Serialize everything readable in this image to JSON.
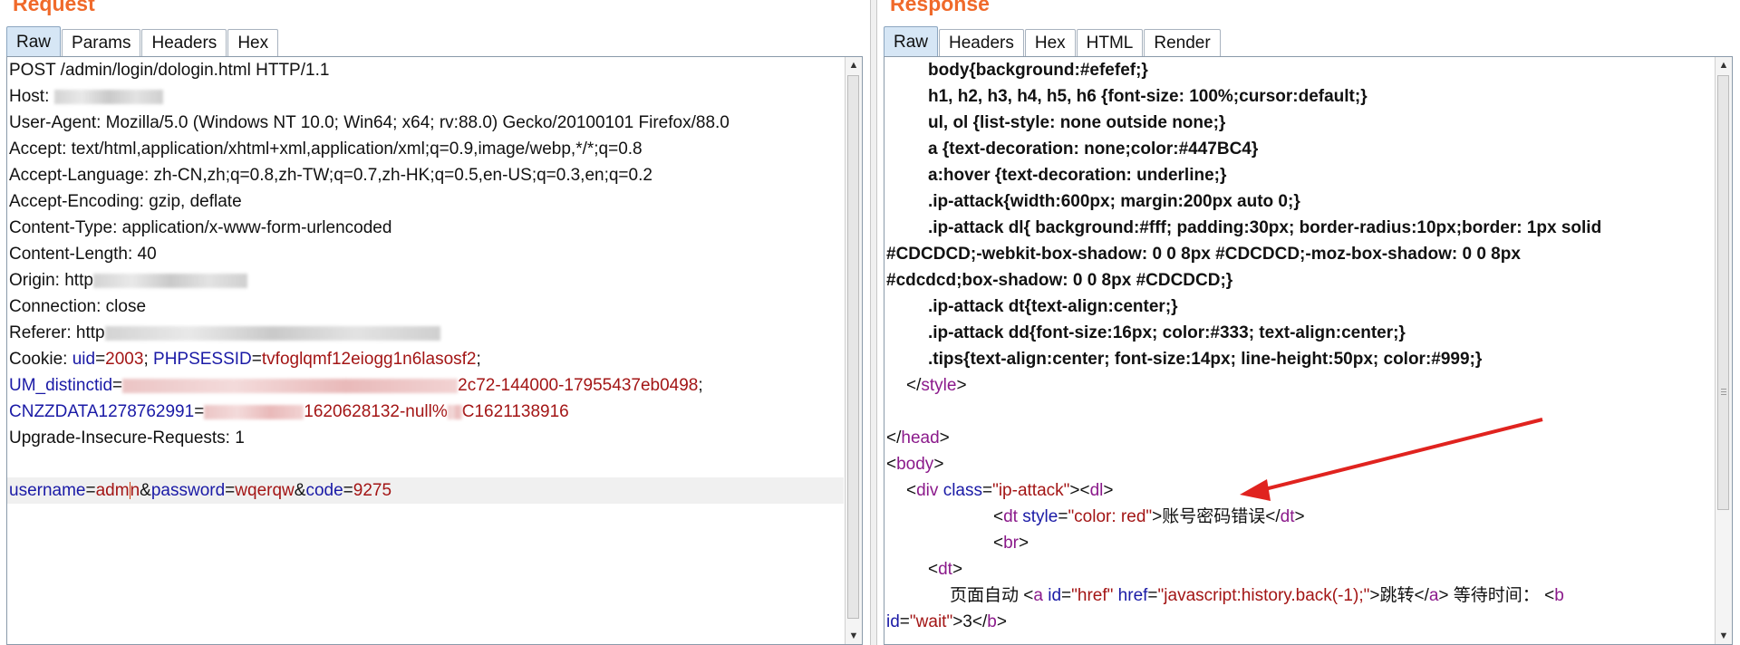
{
  "request": {
    "title": "Request",
    "tabs": [
      "Raw",
      "Params",
      "Headers",
      "Hex"
    ],
    "lines": {
      "l1": "POST /admin/login/dologin.html HTTP/1.1",
      "l2": "Host: ",
      "l3": "User-Agent: Mozilla/5.0 (Windows NT 10.0; Win64; x64; rv:88.0) Gecko/20100101 Firefox/88.0",
      "l4": "Accept: text/html,application/xhtml+xml,application/xml;q=0.9,image/webp,*/*;q=0.8",
      "l5": "Accept-Language: zh-CN,zh;q=0.8,zh-TW;q=0.7,zh-HK;q=0.5,en-US;q=0.3,en;q=0.2",
      "l6": "Accept-Encoding: gzip, deflate",
      "l7": "Content-Type: application/x-www-form-urlencoded",
      "l8": "Content-Length: 40",
      "l9": "Origin: http",
      "l10": "Connection: close",
      "l11": "Referer: http",
      "cookie": {
        "label": "Cookie: ",
        "k1": "uid",
        "v1": "2003",
        "k2": "PHPSESSID",
        "v2": "tvfoglqmf12eiogg1n6lasosf2",
        "k3": "UM_distinctid",
        "v3_tail": "2c72-144000-17955437eb0498",
        "k4": "CNZZDATA1278762991",
        "v4_mid": "1620628132-null%",
        "v4_tail": "C1621138916"
      },
      "l15": "Upgrade-Insecure-Requests: 1",
      "body": {
        "k1": "username",
        "v1a": "adm",
        "v1b": "n",
        "k2": "password",
        "v2": "wqerqw",
        "k3": "code",
        "v3": "9275"
      }
    }
  },
  "response": {
    "title": "Response",
    "tabs": [
      "Raw",
      "Headers",
      "Hex",
      "HTML",
      "Render"
    ],
    "css": {
      "c1": "body{background:#efefef;}",
      "c2": "h1, h2, h3, h4, h5, h6 {font-size: 100%;cursor:default;}",
      "c3": "ul, ol {list-style: none outside none;}",
      "c4": "a {text-decoration: none;color:#447BC4}",
      "c5": "a:hover {text-decoration: underline;}",
      "c6": ".ip-attack{width:600px; margin:200px auto 0;}",
      "c7": ".ip-attack dl{ background:#fff; padding:30px; border-radius:10px;border: 1px solid",
      "c8": "#CDCDCD;-webkit-box-shadow: 0 0 8px #CDCDCD;-moz-box-shadow: 0 0 8px",
      "c9": "#cdcdcd;box-shadow: 0 0 8px #CDCDCD;}",
      "c10": ".ip-attack dt{text-align:center;}",
      "c11": ".ip-attack dd{font-size:16px; color:#333; text-align:center;}",
      "c12": ".tips{text-align:center; font-size:14px; line-height:50px; color:#999;}"
    },
    "html": {
      "style": "style",
      "head": "head",
      "body": "body",
      "div": "div",
      "class_attr": "class",
      "class_val": "\"ip-attack\"",
      "dl": "dl",
      "dt": "dt",
      "style_attr": "style",
      "style_val": "\"color: red\"",
      "error_text": "账号密码错误",
      "br": "br",
      "page_auto": "页面自动 ",
      "a": "a",
      "id_attr": "id",
      "id_val": "\"href\"",
      "href_attr": "href",
      "href_val": "\"javascript:history.back(-1);\"",
      "jump_text": "跳转",
      "wait_text": " 等待时间： ",
      "b": "b",
      "wait_id_val": "\"wait\"",
      "wait_num": "3"
    }
  },
  "colors": {
    "title_orange": "#f06a2b",
    "tab_active_bg": "#d6e6f5",
    "key_blue": "#1a1aa6",
    "value_red": "#a31515",
    "tag_purple": "#8b1a8b",
    "arrow_red": "#e0231f"
  }
}
